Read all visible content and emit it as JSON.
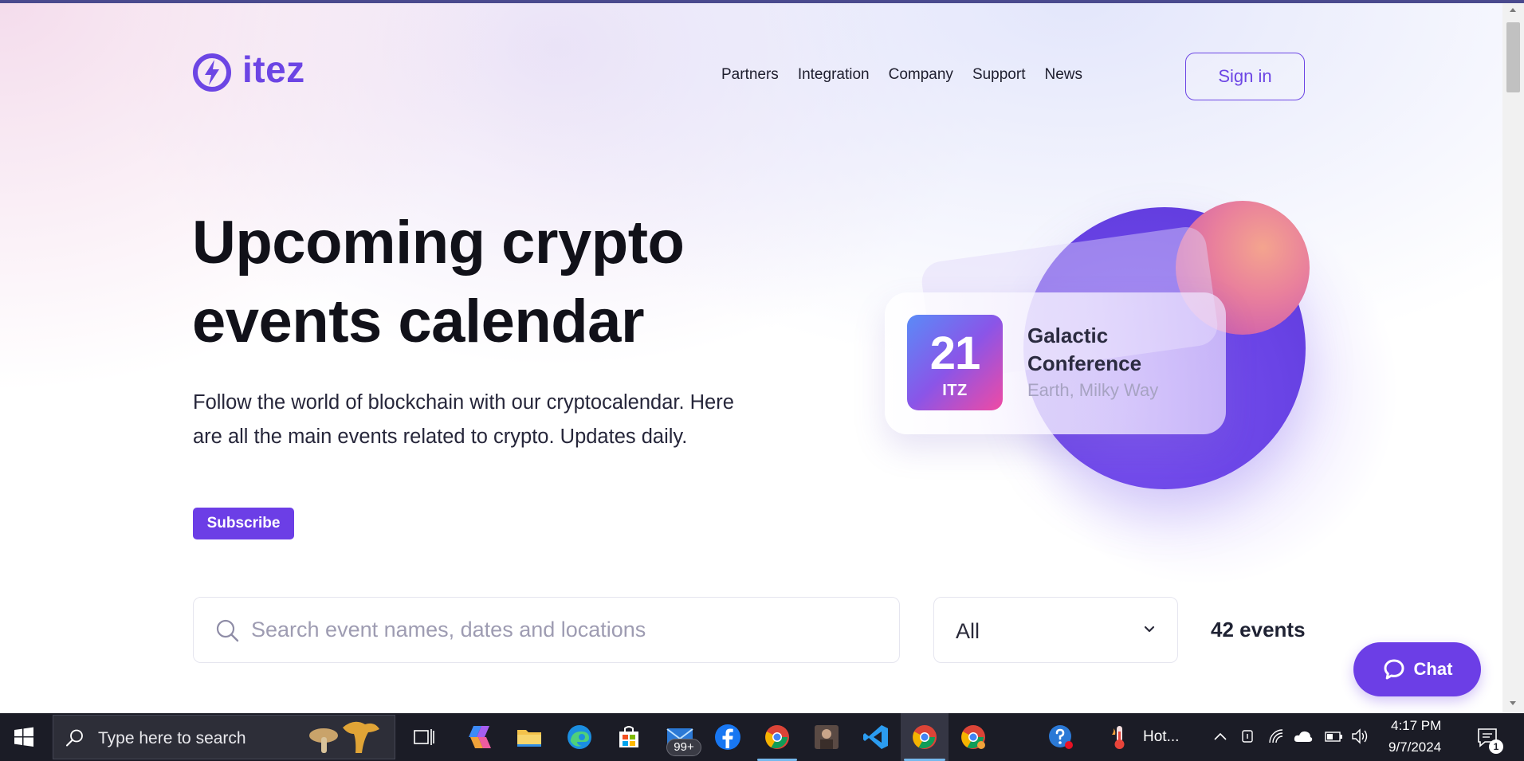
{
  "brand": {
    "name": "itez",
    "accent_color": "#6c45e4"
  },
  "nav": {
    "items": [
      "Partners",
      "Integration",
      "Company",
      "Support",
      "News"
    ],
    "signin_label": "Sign in"
  },
  "hero": {
    "title": "Upcoming crypto events calendar",
    "subtitle": "Follow the world of blockchain with our cryptocalendar. Here are all the main events related to crypto. Updates daily.",
    "subscribe_label": "Subscribe"
  },
  "featured_event": {
    "day": "21",
    "tag": "ITZ",
    "name": "Galactic Conference",
    "location": "Earth, Milky Way"
  },
  "search": {
    "placeholder": "Search event names, dates and locations",
    "value": ""
  },
  "filter": {
    "selected": "All"
  },
  "events_count": "42 events",
  "chat": {
    "label": "Chat"
  },
  "taskbar": {
    "search_placeholder": "Type here to search",
    "mail_badge": "99+",
    "weather_text": "Hot...",
    "time": "4:17 PM",
    "date": "9/7/2024",
    "notification_count": "1",
    "apps": [
      "task-view",
      "copilot",
      "file-explorer",
      "edge",
      "microsoft-store",
      "mail",
      "facebook",
      "chrome",
      "game",
      "vscode",
      "chrome-active",
      "chrome-alt"
    ]
  }
}
